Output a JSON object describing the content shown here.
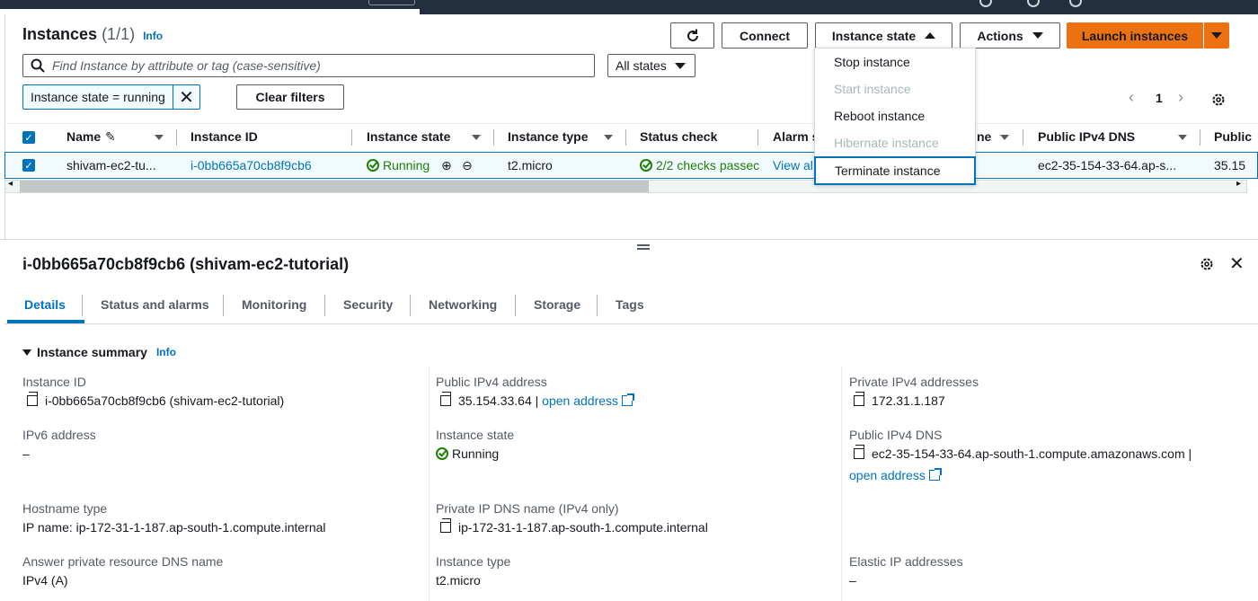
{
  "header": {
    "title": "Instances",
    "count": "(1/1)",
    "info": "Info",
    "refresh_icon": "refresh-icon",
    "connect": "Connect",
    "instance_state": "Instance state",
    "actions": "Actions",
    "launch": "Launch instances"
  },
  "filters": {
    "search_placeholder": "Find Instance by attribute or tag (case-sensitive)",
    "states_select": "All states",
    "token": "Instance state = running",
    "clear": "Clear filters"
  },
  "pagination": {
    "page": "1"
  },
  "table": {
    "columns": [
      "Name",
      "Instance ID",
      "Instance state",
      "Instance type",
      "Status check",
      "Alarm s",
      "ne",
      "Public IPv4 DNS",
      "Public"
    ],
    "row": {
      "name": "shivam-ec2-tu...",
      "instance_id": "i-0bb665a70cb8f9cb6",
      "state": "Running",
      "type": "t2.micro",
      "status": "2/2 checks passec",
      "alarm": "View al",
      "dns": "ec2-35-154-33-64.ap-s...",
      "public": "35.15"
    }
  },
  "menu": {
    "items": [
      {
        "label": "Stop instance",
        "disabled": false
      },
      {
        "label": "Start instance",
        "disabled": true
      },
      {
        "label": "Reboot instance",
        "disabled": false
      },
      {
        "label": "Hibernate instance",
        "disabled": true
      },
      {
        "label": "Terminate instance",
        "disabled": false
      }
    ]
  },
  "details": {
    "title": "i-0bb665a70cb8f9cb6 (shivam-ec2-tutorial)",
    "tabs": [
      "Details",
      "Status and alarms",
      "Monitoring",
      "Security",
      "Networking",
      "Storage",
      "Tags"
    ],
    "summary_title": "Instance summary",
    "summary_info": "Info",
    "fields": {
      "instance_id_label": "Instance ID",
      "instance_id_value": "i-0bb665a70cb8f9cb6 (shivam-ec2-tutorial)",
      "public_ipv4_label": "Public IPv4 address",
      "public_ipv4_value": "35.154.33.64 |",
      "public_ipv4_link": "open address",
      "private_ipv4_label": "Private IPv4 addresses",
      "private_ipv4_value": "172.31.1.187",
      "ipv6_label": "IPv6 address",
      "ipv6_value": "–",
      "state_label": "Instance state",
      "state_value": "Running",
      "public_dns_label": "Public IPv4 DNS",
      "public_dns_value": "ec2-35-154-33-64.ap-south-1.compute.amazonaws.com |",
      "public_dns_link": "open address",
      "hostname_label": "Hostname type",
      "hostname_value": "IP name: ip-172-31-1-187.ap-south-1.compute.internal",
      "private_dns_label": "Private IP DNS name (IPv4 only)",
      "private_dns_value": "ip-172-31-1-187.ap-south-1.compute.internal",
      "answer_dns_label": "Answer private resource DNS name",
      "answer_dns_value": "IPv4 (A)",
      "type_label": "Instance type",
      "type_value": "t2.micro",
      "elastic_label": "Elastic IP addresses",
      "elastic_value": "–"
    }
  },
  "colors": {
    "accent": "#0073bb",
    "launch": "#ec7211",
    "success": "#1d8102"
  }
}
